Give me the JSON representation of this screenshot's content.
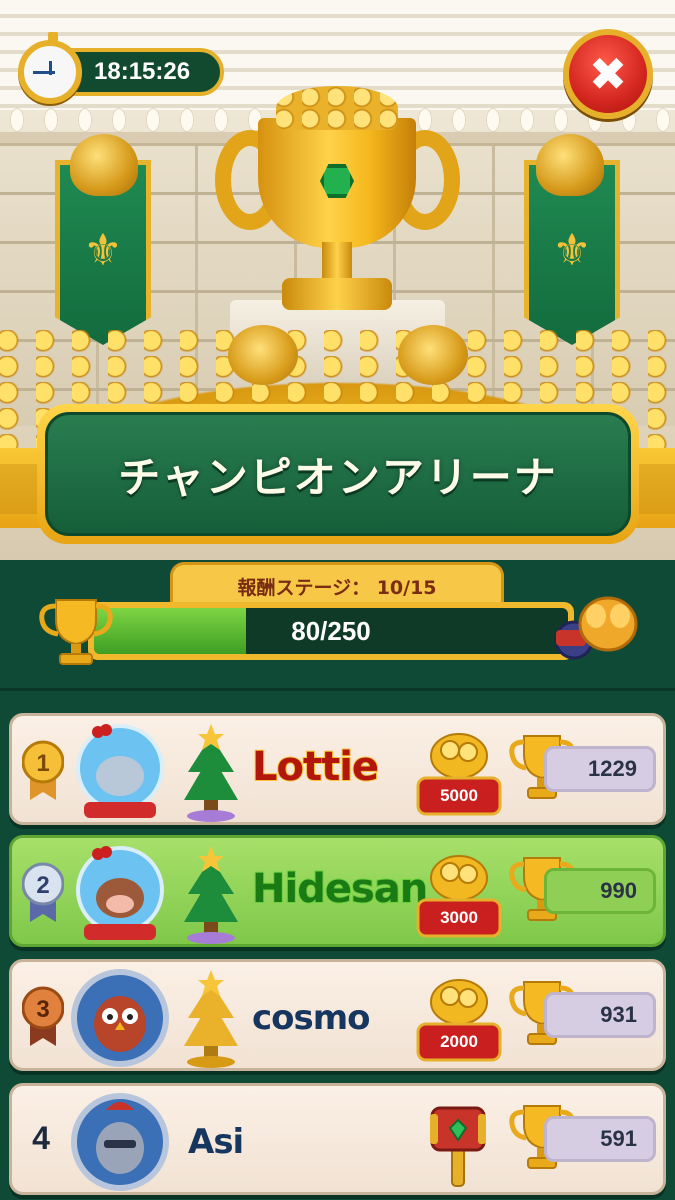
{
  "header": {
    "timer": "18:15:26",
    "title": "チャンピオンアリーナ"
  },
  "progress": {
    "stage_label": "報酬ステージ： 10/15",
    "value_text": "80/250",
    "fraction": 0.32
  },
  "leaderboard": [
    {
      "rank": "1",
      "name": "Lottie",
      "reward": "5000",
      "trophies": "1229",
      "reward_type": "coins",
      "avatar": "snow-globe-walrus-icon",
      "decoration": "christmas-tree-icon"
    },
    {
      "rank": "2",
      "name": "Hidesan",
      "reward": "3000",
      "trophies": "990",
      "reward_type": "coins",
      "avatar": "snow-globe-cow-icon",
      "decoration": "christmas-tree-icon"
    },
    {
      "rank": "3",
      "name": "cosmo",
      "reward": "2000",
      "trophies": "931",
      "reward_type": "coins",
      "avatar": "owl-avatar-icon",
      "decoration": "golden-tree-icon"
    },
    {
      "rank": "4",
      "name": "Asi",
      "reward": "",
      "trophies": "591",
      "reward_type": "hammer",
      "avatar": "knight-avatar-icon",
      "decoration": ""
    }
  ],
  "colors": {
    "board_bg": "#0f4a36",
    "gold": "#e6b02a",
    "highlight_row": "#8fcf55",
    "close_red": "#d2261f"
  }
}
